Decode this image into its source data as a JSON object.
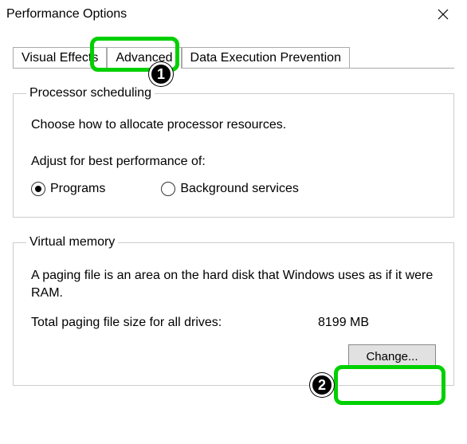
{
  "window": {
    "title": "Performance Options"
  },
  "tabs": {
    "visual_effects": "Visual Effects",
    "advanced": "Advanced",
    "dep": "Data Execution Prevention"
  },
  "callouts": {
    "one": "1",
    "two": "2"
  },
  "processor": {
    "legend": "Processor scheduling",
    "desc": "Choose how to allocate processor resources.",
    "adjust_label": "Adjust for best performance of:",
    "radio_programs": "Programs",
    "radio_background": "Background services"
  },
  "virtual_memory": {
    "legend": "Virtual memory",
    "desc": "A paging file is an area on the hard disk that Windows uses as if it were RAM.",
    "total_label": "Total paging file size for all drives:",
    "total_value": "8199 MB",
    "change_btn": "Change..."
  }
}
